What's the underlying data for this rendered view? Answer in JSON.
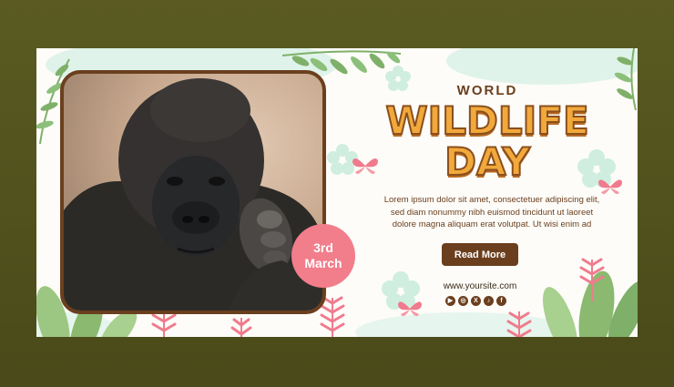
{
  "banner": {
    "title_top": "WORLD",
    "title_line1": "WILDLIFE",
    "title_line2": "DAY",
    "body_line1": "Lorem ipsum dolor sit amet, consectetuer adipiscing elit,",
    "body_line2": "sed diam nonummy nibh euismod tincidunt ut laoreet",
    "body_line3": "dolore magna aliquam erat volutpat. Ut wisi enim ad",
    "cta_label": "Read More",
    "website": "www.yoursite.com",
    "date_day": "3rd",
    "date_month": "March"
  },
  "socials": [
    {
      "name": "youtube-icon",
      "glyph": "▶"
    },
    {
      "name": "instagram-icon",
      "glyph": "◎"
    },
    {
      "name": "x-icon",
      "glyph": "X"
    },
    {
      "name": "tiktok-icon",
      "glyph": "♪"
    },
    {
      "name": "facebook-icon",
      "glyph": "f"
    }
  ],
  "colors": {
    "brown": "#6b3f1e",
    "title_orange": "#f2a93b",
    "badge_pink": "#f27d8b",
    "leaf_green": "#7fb069",
    "mint": "#cfeee0",
    "butterfly_pink": "#f07b8d"
  }
}
